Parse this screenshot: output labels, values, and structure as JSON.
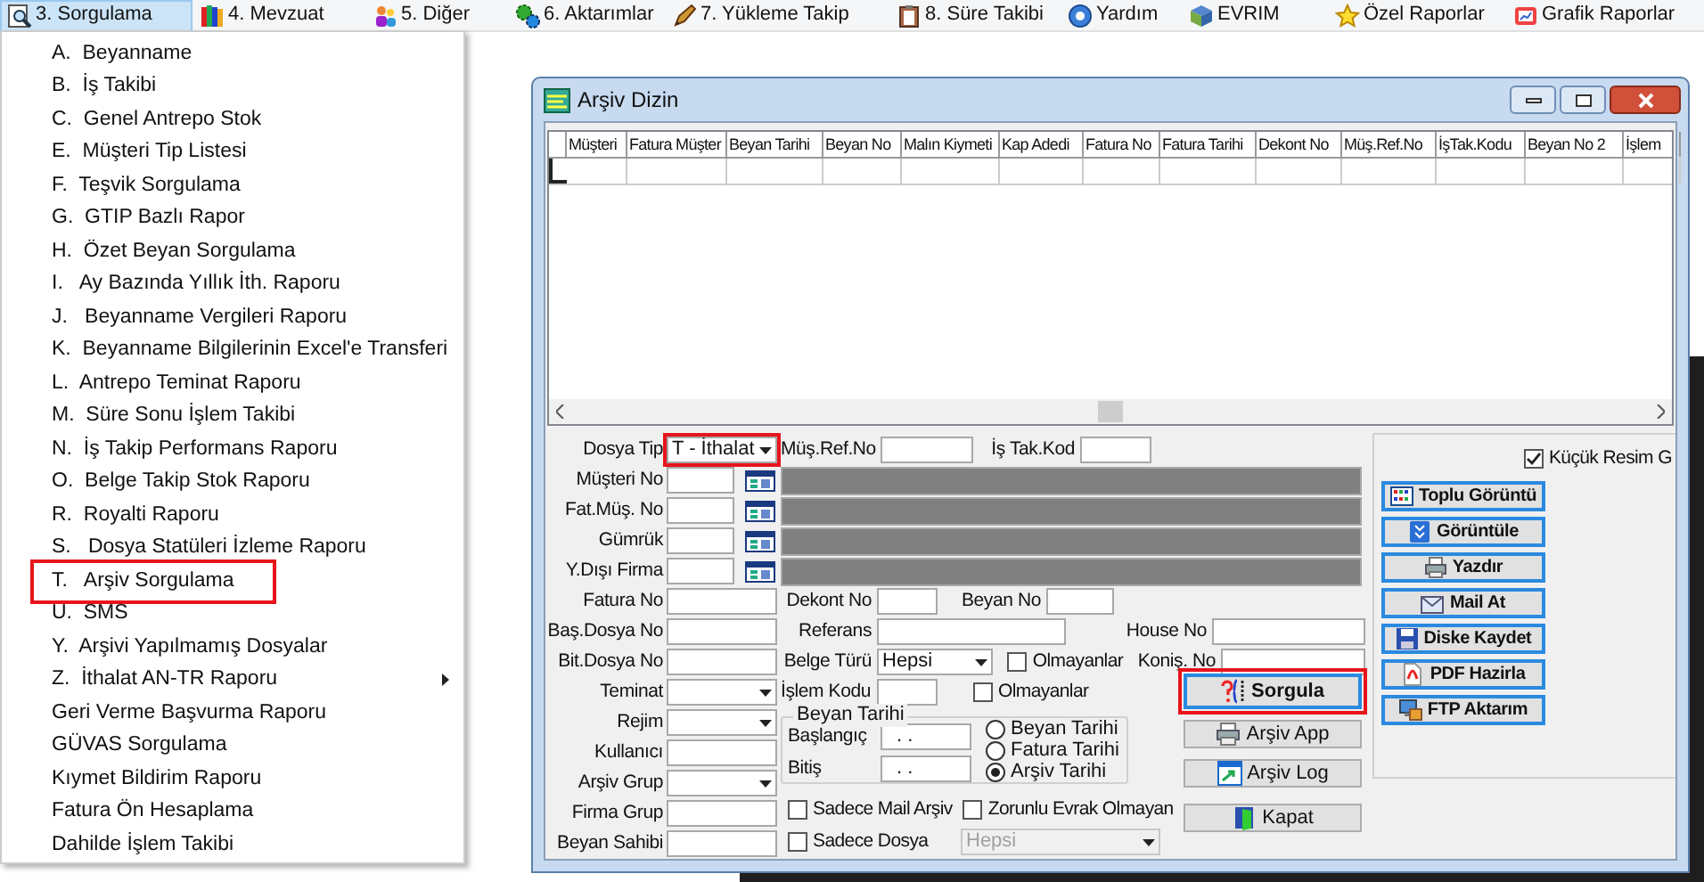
{
  "menu_bar": [
    {
      "label": "3. Sorgulama",
      "selected": true
    },
    {
      "label": "4. Mevzuat",
      "selected": false
    },
    {
      "label": "5. Diğer",
      "selected": false
    },
    {
      "label": "6. Aktarımlar",
      "selected": false
    },
    {
      "label": "7. Yükleme Takip",
      "selected": false
    },
    {
      "label": "8. Süre Takibi",
      "selected": false
    },
    {
      "label": "Yardım",
      "selected": false
    },
    {
      "label": "EVRIM",
      "selected": false
    },
    {
      "label": "Özel Raporlar",
      "selected": false
    },
    {
      "label": "Grafik Raporlar",
      "selected": false
    }
  ],
  "dropdown": [
    {
      "label": "A.  Beyanname",
      "submenu": false,
      "annotated": false
    },
    {
      "label": "B.  İş Takibi",
      "submenu": false,
      "annotated": false
    },
    {
      "label": "C.  Genel Antrepo Stok",
      "submenu": false,
      "annotated": false
    },
    {
      "label": "E.  Müşteri Tip Listesi",
      "submenu": false,
      "annotated": false
    },
    {
      "label": "F.  Teşvik Sorgulama",
      "submenu": false,
      "annotated": false
    },
    {
      "label": "G.  GTIP Bazlı Rapor",
      "submenu": false,
      "annotated": false
    },
    {
      "label": "H.  Özet Beyan Sorgulama",
      "submenu": false,
      "annotated": false
    },
    {
      "label": "I.   Ay Bazında Yıllık İth. Raporu",
      "submenu": false,
      "annotated": false
    },
    {
      "label": "J.   Beyanname Vergileri Raporu",
      "submenu": false,
      "annotated": false
    },
    {
      "label": "K.  Beyanname Bilgilerinin Excel'e Transferi",
      "submenu": false,
      "annotated": false
    },
    {
      "label": "L.  Antrepo Teminat Raporu",
      "submenu": false,
      "annotated": false
    },
    {
      "label": "M.  Süre Sonu İşlem Takibi",
      "submenu": false,
      "annotated": false
    },
    {
      "label": "N.  İş Takip Performans Raporu",
      "submenu": false,
      "annotated": false
    },
    {
      "label": "O.  Belge Takip Stok Raporu",
      "submenu": false,
      "annotated": false
    },
    {
      "label": "R.  Royalti Raporu",
      "submenu": false,
      "annotated": false
    },
    {
      "label": "S.   Dosya Statüleri İzleme Raporu",
      "submenu": false,
      "annotated": false
    },
    {
      "label": "T.   Arşiv Sorgulama",
      "submenu": false,
      "annotated": true
    },
    {
      "label": "U.  SMS",
      "submenu": false,
      "annotated": false
    },
    {
      "label": "Y.  Arşivi Yapılmamış Dosyalar",
      "submenu": false,
      "annotated": false
    },
    {
      "label": "Z.  İthalat AN-TR Raporu",
      "submenu": true,
      "annotated": false
    },
    {
      "label": "Geri Verme Başvurma Raporu",
      "submenu": false,
      "annotated": false
    },
    {
      "label": "GÜVAS Sorgulama",
      "submenu": false,
      "annotated": false
    },
    {
      "label": "Kıymet Bildirim Raporu",
      "submenu": false,
      "annotated": false
    },
    {
      "label": "Fatura Ön Hesaplama",
      "submenu": false,
      "annotated": false
    },
    {
      "label": "Dahilde İşlem Takibi",
      "submenu": false,
      "annotated": false
    }
  ],
  "window": {
    "title": "Arşiv Dizin"
  },
  "table": {
    "columns": [
      "Müşteri",
      "Fatura Müşter",
      "Beyan Tarihi",
      "Beyan No",
      "Malın Kiymeti",
      "Kap Adedi",
      "Fatura No",
      "Fatura Tarihi",
      "Dekont No",
      "Müş.Ref.No",
      "İşTak.Kodu",
      "Beyan No 2",
      "İşlem"
    ]
  },
  "form": {
    "left_fields": [
      {
        "label": "Dosya Tip",
        "kind": "dropdown",
        "value": "T - İthalat",
        "annotated": true
      },
      {
        "label": "Müşteri No",
        "kind": "lookup"
      },
      {
        "label": "Fat.Müş. No",
        "kind": "lookup"
      },
      {
        "label": "Gümrük",
        "kind": "lookup"
      },
      {
        "label": "Y.Dışı Firma",
        "kind": "lookup"
      },
      {
        "label": "Fatura No",
        "kind": "text"
      },
      {
        "label": "Baş.Dosya No",
        "kind": "text"
      },
      {
        "label": "Bit.Dosya No",
        "kind": "text"
      },
      {
        "label": "Teminat",
        "kind": "select"
      },
      {
        "label": "Rejim",
        "kind": "select"
      },
      {
        "label": "Kullanıcı",
        "kind": "text"
      },
      {
        "label": "Arşiv Grup",
        "kind": "select"
      },
      {
        "label": "Firma Grup",
        "kind": "text"
      },
      {
        "label": "Beyan Sahibi",
        "kind": "text"
      }
    ],
    "mus_ref_no": "Müş.Ref.No",
    "is_tak_kod": "İş Tak.Kod",
    "dekont_no": "Dekont No",
    "beyan_no": "Beyan No",
    "referans": "Referans",
    "house_no": "House No",
    "belge_turu": {
      "label": "Belge Türü",
      "value": "Hepsi"
    },
    "belge_olmayanlar": {
      "label": "Olmayanlar",
      "checked": false
    },
    "konis_no": "Koniş. No",
    "islem_kodu": "İşlem Kodu",
    "islem_olmayanlar": {
      "label": "Olmayanlar",
      "checked": false
    },
    "beyan_tarihi": {
      "title": "Beyan Tarihi",
      "start_label": "Başlangıç",
      "start_value": ". .",
      "end_label": "Bitiş",
      "end_value": ". .",
      "options": [
        {
          "label": "Beyan Tarihi",
          "selected": false
        },
        {
          "label": "Fatura Tarihi",
          "selected": false
        },
        {
          "label": "Arşiv Tarihi",
          "selected": true
        }
      ]
    },
    "checkboxes": [
      {
        "label": "Sadece Mail Arşiv",
        "checked": false
      },
      {
        "label": "Zorunlu Evrak Olmayan",
        "checked": false
      },
      {
        "label": "Sadece Dosya",
        "checked": false
      }
    ],
    "filter_select": {
      "value": "Hepsi",
      "disabled": true
    },
    "actions": [
      {
        "label": "Sorgula",
        "annotated": true,
        "focused": true
      },
      {
        "label": "Arşiv App",
        "annotated": false,
        "focused": false
      },
      {
        "label": "Arşiv Log",
        "annotated": false,
        "focused": false
      },
      {
        "label": "Kapat",
        "annotated": false,
        "focused": false
      }
    ],
    "thumbnail_checkbox": {
      "label": "Küçük Resim G",
      "checked": true
    },
    "side_buttons": [
      "Toplu Görüntü",
      "Görüntüle",
      "Yazdır",
      "Mail At",
      "Diske Kaydet",
      "PDF Hazirla",
      "FTP Aktarım"
    ]
  }
}
